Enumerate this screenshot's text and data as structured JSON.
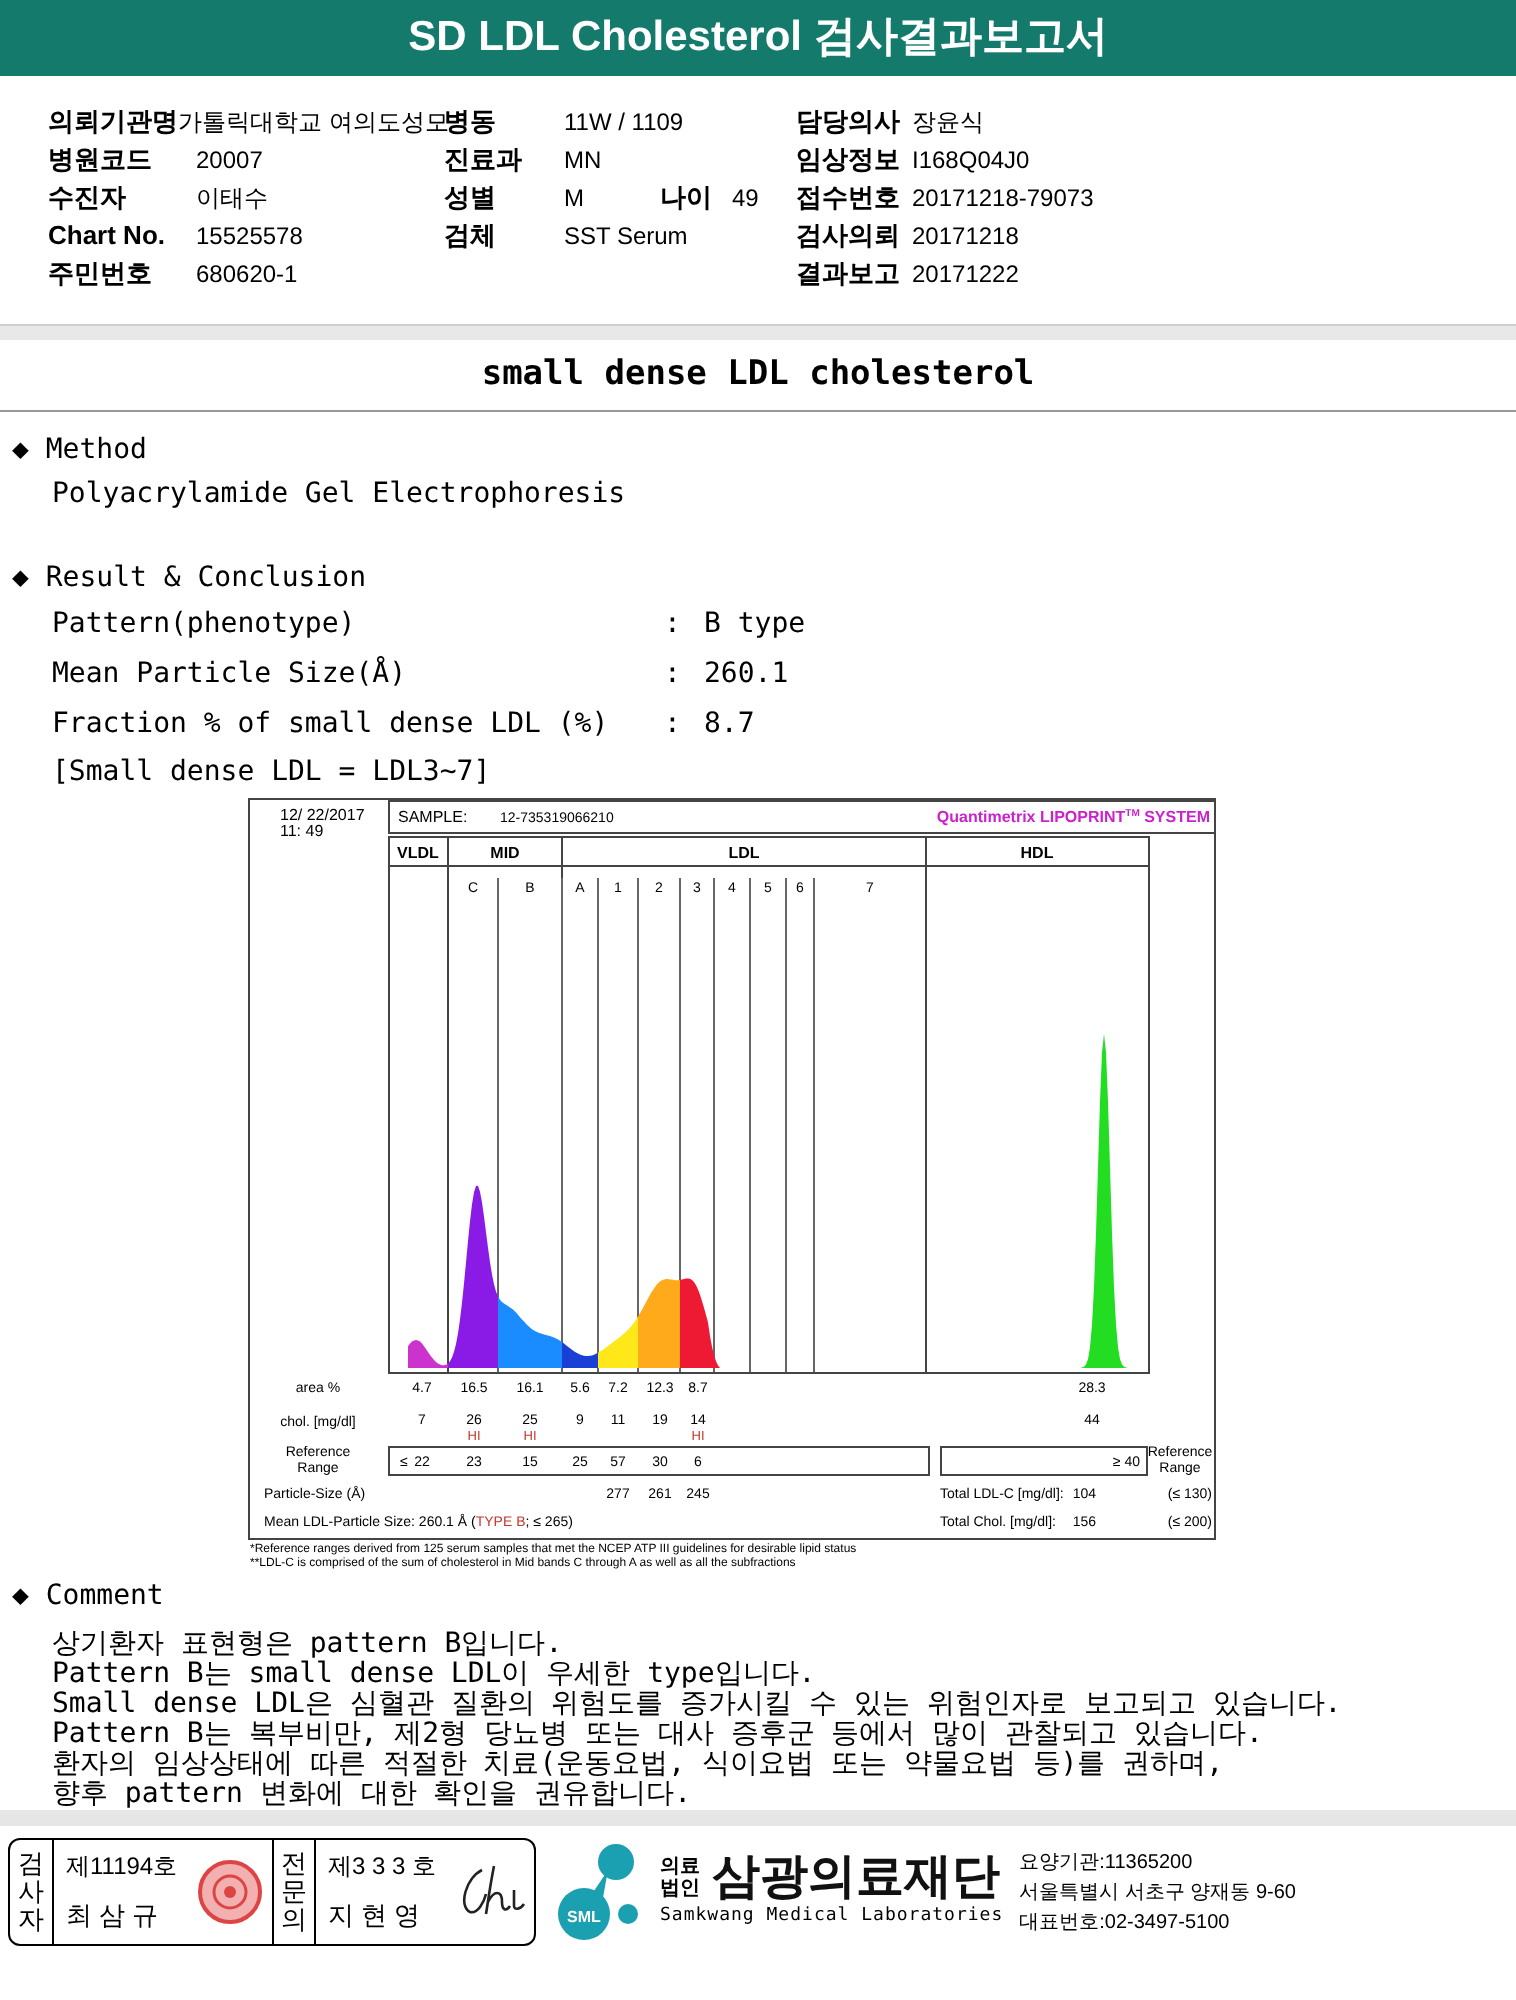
{
  "title": "SD LDL Cholesterol 검사결과보고서",
  "info_rows": [
    {
      "left": {
        "label": "의뢰기관명",
        "value": "가톨릭대학교 여의도성모"
      },
      "middle": {
        "label": "병동",
        "value": "11W / 1109"
      },
      "right": {
        "label": "담당의사",
        "value": "장윤식"
      }
    },
    {
      "left": {
        "label": "병원코드",
        "value": "20007"
      },
      "middle": {
        "label": "진료과",
        "value": "MN"
      },
      "right": {
        "label": "임상정보",
        "value": "I168Q04J0"
      }
    },
    {
      "left": {
        "label": "수진자",
        "value": "이태수"
      },
      "middle": {
        "label": "성별",
        "value": "M",
        "extra_label": "나이",
        "extra_value": "49"
      },
      "right": {
        "label": "접수번호",
        "value": "20171218-79073"
      }
    },
    {
      "left": {
        "label": "Chart No.",
        "value": "15525578"
      },
      "middle": {
        "label": "검체",
        "value": "SST Serum"
      },
      "right": {
        "label": "검사의뢰",
        "value": "20171218"
      }
    },
    {
      "left": {
        "label": "주민번호",
        "value": "680620-1"
      },
      "right": {
        "label": "결과보고",
        "value": "20171222"
      }
    }
  ],
  "subtitle": "small dense LDL cholesterol",
  "method": {
    "heading": "◆ Method",
    "text": "Polyacrylamide Gel Electrophoresis"
  },
  "result": {
    "heading": "◆ Result & Conclusion",
    "rows": [
      {
        "label": "Pattern(phenotype)",
        "sep": ":",
        "value": "B type"
      },
      {
        "label": "Mean Particle Size(Å)",
        "sep": ":",
        "value": "260.1"
      },
      {
        "label": "Fraction % of small dense LDL (%)",
        "sep": ":",
        "value": "8.7"
      }
    ],
    "note": "[Small dense LDL = LDL3~7]"
  },
  "lipoprint": {
    "date": "12/ 22/2017",
    "time": "11: 49",
    "sample_label": "SAMPLE:",
    "sample_id": "12-735319066210",
    "system": "Quantimetrix LIPOPRINT$^{TM}$ SYSTEM",
    "bands": [
      "VLDL",
      "MID",
      "LDL",
      "HDL"
    ],
    "subbands": [
      "C",
      "B",
      "A",
      "1",
      "2",
      "3",
      "4",
      "5",
      "6",
      "7"
    ],
    "area_label": "area %",
    "chol_label": "chol. [mg/dl]",
    "ref_label": "Reference Range",
    "ref_prefix": "≤",
    "values": [
      {
        "area": "4.7",
        "chol": "7",
        "ref": "22"
      },
      {
        "area": "16.5",
        "chol": "26",
        "flag": "HI",
        "ref": "23"
      },
      {
        "area": "16.1",
        "chol": "25",
        "flag": "HI",
        "ref": "15"
      },
      {
        "area": "5.6",
        "chol": "9",
        "ref": "25"
      },
      {
        "area": "7.2",
        "chol": "11",
        "ref": "57",
        "size": "277"
      },
      {
        "area": "12.3",
        "chol": "19",
        "ref": "30",
        "size": "261"
      },
      {
        "area": "8.7",
        "chol": "14",
        "flag": "HI",
        "ref": "6",
        "size": "245"
      }
    ],
    "hdl": {
      "area": "28.3",
      "chol": "44",
      "ref": "≥ 40"
    },
    "ref_label_right": "Reference Range",
    "size_label": "Particle-Size (Å)",
    "mean_label": "Mean LDL-Particle Size:",
    "mean_value": "260.1 Å",
    "type_open": "(",
    "type": "TYPE B",
    "type_rest": "; ≤ 265)",
    "totals": [
      {
        "label": "Total LDL-C [mg/dl]:",
        "value": "104",
        "range": "(≤ 130)"
      },
      {
        "label": "Total Chol. [mg/dl]:",
        "value": "156",
        "range": "(≤ 200)"
      }
    ],
    "footnotes": [
      "*Reference ranges derived from 125 serum samples that met the NCEP ATP III guidelines for desirable lipid status",
      "**LDL-C is comprised of the sum of cholesterol in Mid bands C through A as well as all the subfractions"
    ]
  },
  "comment": {
    "heading": "◆ Comment",
    "lines": [
      "상기환자 표현형은 pattern B입니다.",
      "Pattern B는 small dense LDL이 우세한 type입니다.",
      "Small dense LDL은 심혈관 질환의 위험도를 증가시킬 수 있는 위험인자로 보고되고 있습니다.",
      "Pattern B는 복부비만, 제2형 당뇨병 또는 대사 증후군 등에서 많이 관찰되고 있습니다.",
      "환자의 임상상태에 따른 적절한 치료(운동요법, 식이요법 또는 약물요법 등)를 권하며,",
      "향후 pattern 변화에 대한 확인을 권유합니다."
    ]
  },
  "signers": [
    {
      "role": "검사자",
      "number": "제11194호",
      "name": "최 삼 규",
      "kind": "stamp"
    },
    {
      "role": "전문의",
      "number": "제3 3 3 호",
      "name": "지 현 영",
      "kind": "signature"
    }
  ],
  "lab": {
    "corp": "의료법인",
    "name": "삼광의료재단",
    "english": "Samkwang Medical Laboratories",
    "logo_text": "SML",
    "lines": [
      "요양기관:11365200",
      "서울특별시 서초구 양재동 9-60",
      "대표번호:02-3497-5100"
    ]
  }
}
